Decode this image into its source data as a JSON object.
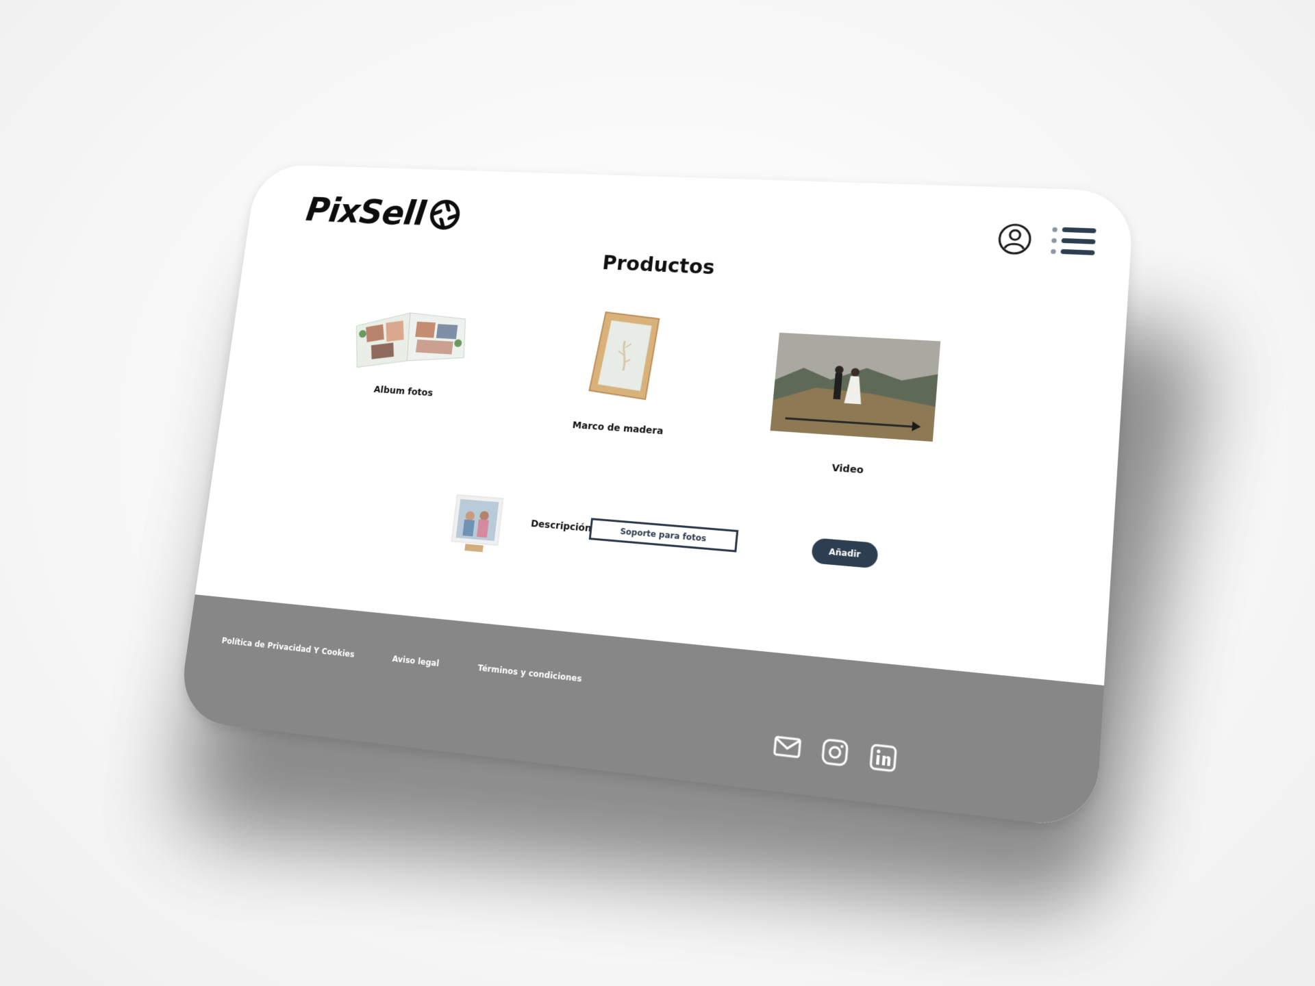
{
  "brand": {
    "name": "PixSell",
    "logo_icon": "camera-aperture-icon"
  },
  "header": {
    "user_icon": "user-icon",
    "menu_icon": "menu-icon"
  },
  "page": {
    "title": "Productos"
  },
  "products": [
    {
      "label": "Album fotos",
      "image": "photo-album-image"
    },
    {
      "label": "Marco de madera",
      "image": "wooden-frame-image"
    },
    {
      "label": "Video",
      "image": "wedding-video-image"
    }
  ],
  "form": {
    "description_label": "Descripción:",
    "description_value": "Soporte para fotos",
    "add_button": "Añadir",
    "product_image": "photo-stand-image"
  },
  "footer": {
    "links": [
      "Política de Privacidad Y Cookies",
      "Aviso legal",
      "Términos y condiciones"
    ],
    "social": [
      "mail-icon",
      "instagram-icon",
      "linkedin-icon"
    ]
  },
  "colors": {
    "accent": "#2c3e50",
    "footer_bg": "#878787",
    "text": "#111111"
  }
}
